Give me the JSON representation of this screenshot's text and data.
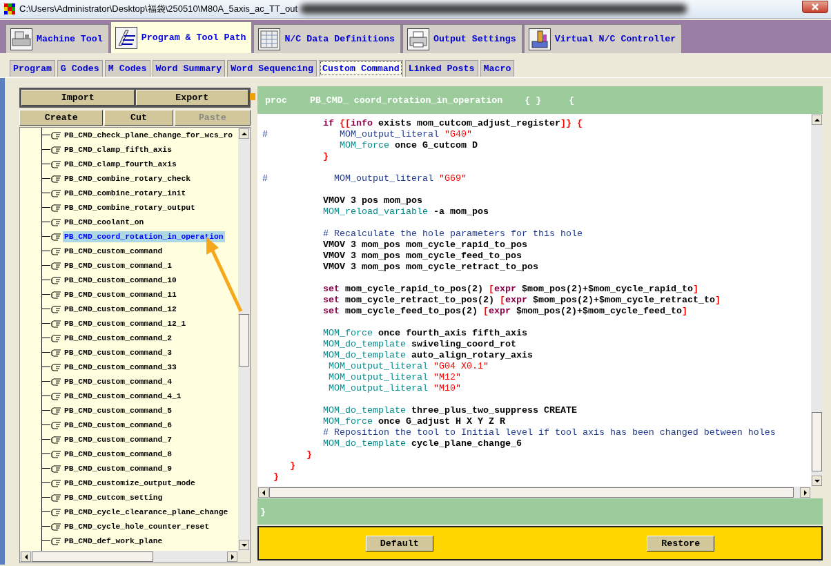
{
  "window": {
    "title": "C:\\Users\\Administrator\\Desktop\\福袋\\250510\\M80A_5axis_ac_TT_out"
  },
  "main_tabs": [
    {
      "label": "Machine Tool",
      "selected": false
    },
    {
      "label": "Program & Tool Path",
      "selected": true
    },
    {
      "label": "N/C Data Definitions",
      "selected": false
    },
    {
      "label": "Output Settings",
      "selected": false
    },
    {
      "label": "Virtual N/C Controller",
      "selected": false
    }
  ],
  "sub_tabs": [
    {
      "label": "Program",
      "selected": false
    },
    {
      "label": "G Codes",
      "selected": false
    },
    {
      "label": "M Codes",
      "selected": false
    },
    {
      "label": "Word Summary",
      "selected": false
    },
    {
      "label": "Word Sequencing",
      "selected": false
    },
    {
      "label": "Custom Command",
      "selected": true
    },
    {
      "label": "Linked Posts",
      "selected": false
    },
    {
      "label": "Macro",
      "selected": false
    }
  ],
  "file_buttons": [
    {
      "label": "Import",
      "disabled": false
    },
    {
      "label": "Export",
      "disabled": false
    }
  ],
  "edit_buttons": [
    {
      "label": "Create",
      "disabled": false
    },
    {
      "label": "Cut",
      "disabled": false
    },
    {
      "label": "Paste",
      "disabled": true
    }
  ],
  "tree": {
    "items": [
      {
        "label": "PB_CMD_check_plane_change_for_wcs_ro",
        "selected": false
      },
      {
        "label": "PB_CMD_clamp_fifth_axis",
        "selected": false
      },
      {
        "label": "PB_CMD_clamp_fourth_axis",
        "selected": false
      },
      {
        "label": "PB_CMD_combine_rotary_check",
        "selected": false
      },
      {
        "label": "PB_CMD_combine_rotary_init",
        "selected": false
      },
      {
        "label": "PB_CMD_combine_rotary_output",
        "selected": false
      },
      {
        "label": "PB_CMD_coolant_on",
        "selected": false
      },
      {
        "label": "PB_CMD_coord_rotation_in_operation",
        "selected": true
      },
      {
        "label": "PB_CMD_custom_command",
        "selected": false
      },
      {
        "label": "PB_CMD_custom_command_1",
        "selected": false
      },
      {
        "label": "PB_CMD_custom_command_10",
        "selected": false
      },
      {
        "label": "PB_CMD_custom_command_11",
        "selected": false
      },
      {
        "label": "PB_CMD_custom_command_12",
        "selected": false
      },
      {
        "label": "PB_CMD_custom_command_12_1",
        "selected": false
      },
      {
        "label": "PB_CMD_custom_command_2",
        "selected": false
      },
      {
        "label": "PB_CMD_custom_command_3",
        "selected": false
      },
      {
        "label": "PB_CMD_custom_command_33",
        "selected": false
      },
      {
        "label": "PB_CMD_custom_command_4",
        "selected": false
      },
      {
        "label": "PB_CMD_custom_command_4_1",
        "selected": false
      },
      {
        "label": "PB_CMD_custom_command_5",
        "selected": false
      },
      {
        "label": "PB_CMD_custom_command_6",
        "selected": false
      },
      {
        "label": "PB_CMD_custom_command_7",
        "selected": false
      },
      {
        "label": "PB_CMD_custom_command_8",
        "selected": false
      },
      {
        "label": "PB_CMD_custom_command_9",
        "selected": false
      },
      {
        "label": "PB_CMD_customize_output_mode",
        "selected": false
      },
      {
        "label": "PB_CMD_cutcom_setting",
        "selected": false
      },
      {
        "label": "PB_CMD_cycle_clearance_plane_change",
        "selected": false
      },
      {
        "label": "PB_CMD_cycle_hole_counter_reset",
        "selected": false
      },
      {
        "label": "PB_CMD_def_work_plane",
        "selected": false
      }
    ]
  },
  "editor": {
    "header": [
      "proc",
      "PB_CMD_ coord_rotation_in_operation",
      "{ }",
      "{"
    ],
    "lines": [
      {
        "kind": "code",
        "tokens": [
          {
            "kind": "kw",
            "text": "           if"
          },
          {
            "kind": "br",
            "text": " {["
          },
          {
            "kind": "kw",
            "text": "info"
          },
          {
            "kind": "txt",
            "text": " exists mom_cutcom_adjust_register"
          },
          {
            "kind": "br",
            "text": "]} {"
          }
        ]
      },
      {
        "kind": "code",
        "tokens": [
          {
            "kind": "cmt",
            "text": "#             MOM_output_literal"
          },
          {
            "kind": "str",
            "text": " \"G40\""
          }
        ]
      },
      {
        "kind": "code",
        "tokens": [
          {
            "kind": "mom",
            "text": "              MOM_force"
          },
          {
            "kind": "txt",
            "text": " once G_cutcom D"
          }
        ]
      },
      {
        "kind": "code",
        "tokens": [
          {
            "kind": "br",
            "text": "           }"
          }
        ]
      },
      {
        "kind": "blank"
      },
      {
        "kind": "code",
        "tokens": [
          {
            "kind": "cmt",
            "text": "#            MOM_output_literal"
          },
          {
            "kind": "str",
            "text": " \"G69\""
          }
        ]
      },
      {
        "kind": "blank"
      },
      {
        "kind": "code",
        "tokens": [
          {
            "kind": "txt",
            "text": "           VMOV 3 pos mom_pos"
          }
        ]
      },
      {
        "kind": "code",
        "tokens": [
          {
            "kind": "mom",
            "text": "           MOM_reload_variable"
          },
          {
            "kind": "txt",
            "text": " -a mom_pos"
          }
        ]
      },
      {
        "kind": "blank"
      },
      {
        "kind": "code",
        "tokens": [
          {
            "kind": "cmt",
            "text": "           # Recalculate the hole parameters for this hole"
          }
        ]
      },
      {
        "kind": "code",
        "tokens": [
          {
            "kind": "txt",
            "text": "           VMOV 3 mom_pos mom_cycle_rapid_to_pos"
          }
        ]
      },
      {
        "kind": "code",
        "tokens": [
          {
            "kind": "txt",
            "text": "           VMOV 3 mom_pos mom_cycle_feed_to_pos"
          }
        ]
      },
      {
        "kind": "code",
        "tokens": [
          {
            "kind": "txt",
            "text": "           VMOV 3 mom_pos mom_cycle_retract_to_pos"
          }
        ]
      },
      {
        "kind": "blank"
      },
      {
        "kind": "code",
        "tokens": [
          {
            "kind": "kw",
            "text": "           set"
          },
          {
            "kind": "txt",
            "text": " mom_cycle_rapid_to_pos(2) "
          },
          {
            "kind": "br",
            "text": "["
          },
          {
            "kind": "kw",
            "text": "expr"
          },
          {
            "kind": "txt",
            "text": " $mom_pos(2)+$mom_cycle_rapid_to"
          },
          {
            "kind": "br",
            "text": "]"
          }
        ]
      },
      {
        "kind": "code",
        "tokens": [
          {
            "kind": "kw",
            "text": "           set"
          },
          {
            "kind": "txt",
            "text": " mom_cycle_retract_to_pos(2) "
          },
          {
            "kind": "br",
            "text": "["
          },
          {
            "kind": "kw",
            "text": "expr"
          },
          {
            "kind": "txt",
            "text": " $mom_pos(2)+$mom_cycle_retract_to"
          },
          {
            "kind": "br",
            "text": "]"
          }
        ]
      },
      {
        "kind": "code",
        "tokens": [
          {
            "kind": "kw",
            "text": "           set"
          },
          {
            "kind": "txt",
            "text": " mom_cycle_feed_to_pos(2) "
          },
          {
            "kind": "br",
            "text": "["
          },
          {
            "kind": "kw",
            "text": "expr"
          },
          {
            "kind": "txt",
            "text": " $mom_pos(2)+$mom_cycle_feed_to"
          },
          {
            "kind": "br",
            "text": "]"
          }
        ]
      },
      {
        "kind": "blank"
      },
      {
        "kind": "code",
        "tokens": [
          {
            "kind": "mom",
            "text": "           MOM_force"
          },
          {
            "kind": "txt",
            "text": " once fourth_axis fifth_axis"
          }
        ]
      },
      {
        "kind": "code",
        "tokens": [
          {
            "kind": "mom",
            "text": "           MOM_do_template"
          },
          {
            "kind": "txt",
            "text": " swiveling_coord_rot"
          }
        ]
      },
      {
        "kind": "code",
        "tokens": [
          {
            "kind": "mom",
            "text": "           MOM_do_template"
          },
          {
            "kind": "txt",
            "text": " auto_align_rotary_axis"
          }
        ]
      },
      {
        "kind": "code",
        "tokens": [
          {
            "kind": "mom",
            "text": "            MOM_output_literal"
          },
          {
            "kind": "str",
            "text": " \"G04 X0.1\""
          }
        ]
      },
      {
        "kind": "code",
        "tokens": [
          {
            "kind": "mom",
            "text": "            MOM_output_literal"
          },
          {
            "kind": "str",
            "text": " \"M12\""
          }
        ]
      },
      {
        "kind": "code",
        "tokens": [
          {
            "kind": "mom",
            "text": "            MOM_output_literal"
          },
          {
            "kind": "str",
            "text": " \"M10\""
          }
        ]
      },
      {
        "kind": "blank"
      },
      {
        "kind": "code",
        "tokens": [
          {
            "kind": "mom",
            "text": "           MOM_do_template"
          },
          {
            "kind": "txt",
            "text": " three_plus_two_suppress CREATE"
          }
        ]
      },
      {
        "kind": "code",
        "tokens": [
          {
            "kind": "mom",
            "text": "           MOM_force"
          },
          {
            "kind": "txt",
            "text": " once G_adjust H X Y Z R"
          }
        ]
      },
      {
        "kind": "code",
        "tokens": [
          {
            "kind": "cmt",
            "text": "           # Reposition the tool to Initial level if tool axis has been changed between holes"
          }
        ]
      },
      {
        "kind": "code",
        "tokens": [
          {
            "kind": "mom",
            "text": "           MOM_do_template"
          },
          {
            "kind": "txt",
            "text": " cycle_plane_change_6"
          }
        ]
      },
      {
        "kind": "code",
        "tokens": [
          {
            "kind": "br",
            "text": "        }"
          }
        ]
      },
      {
        "kind": "code",
        "tokens": [
          {
            "kind": "br",
            "text": "     }"
          }
        ]
      },
      {
        "kind": "code",
        "tokens": [
          {
            "kind": "br",
            "text": "  }"
          }
        ]
      }
    ],
    "footer": "}"
  },
  "actions": [
    "Default",
    "Restore"
  ]
}
